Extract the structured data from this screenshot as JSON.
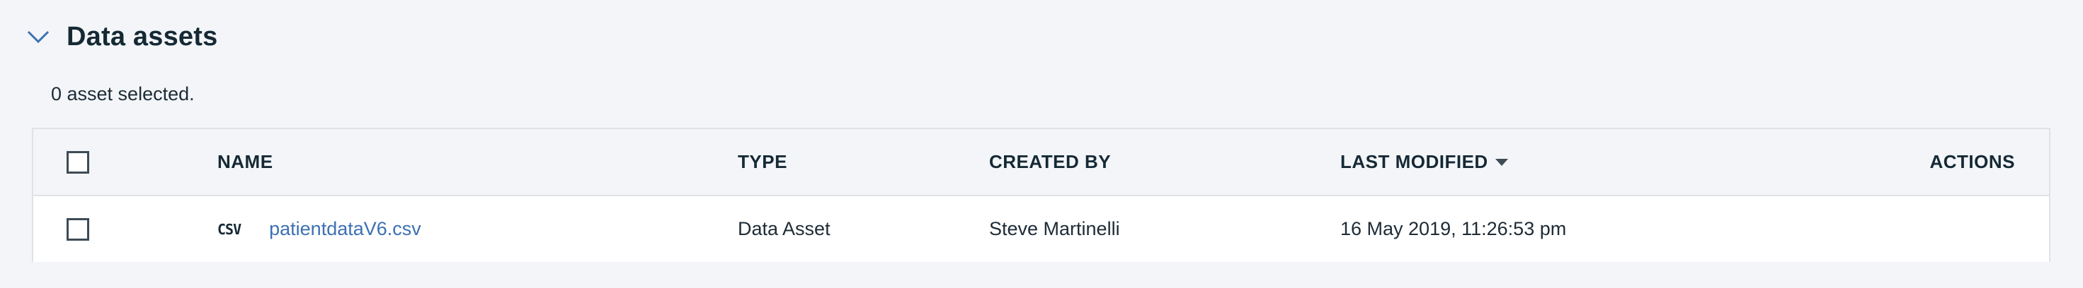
{
  "section": {
    "title": "Data assets",
    "collapse_icon": "chevron-down-icon"
  },
  "selection": {
    "status": "0 asset selected."
  },
  "table": {
    "columns": {
      "name": "NAME",
      "type": "TYPE",
      "created_by": "CREATED BY",
      "last_modified": "LAST MODIFIED",
      "actions": "ACTIONS"
    },
    "sort": {
      "column": "last_modified",
      "direction": "descending",
      "icon": "caret-down-icon"
    },
    "rows": [
      {
        "selected": false,
        "file_type_icon": "CSV",
        "name": "patientdataV6.csv",
        "type": "Data Asset",
        "created_by": "Steve Martinelli",
        "last_modified": "16 May 2019, 11:26:53 pm"
      }
    ]
  },
  "colors": {
    "background": "#f3f5f8",
    "link": "#3d70b2",
    "border": "#dfe3e6",
    "text": "#152935"
  }
}
